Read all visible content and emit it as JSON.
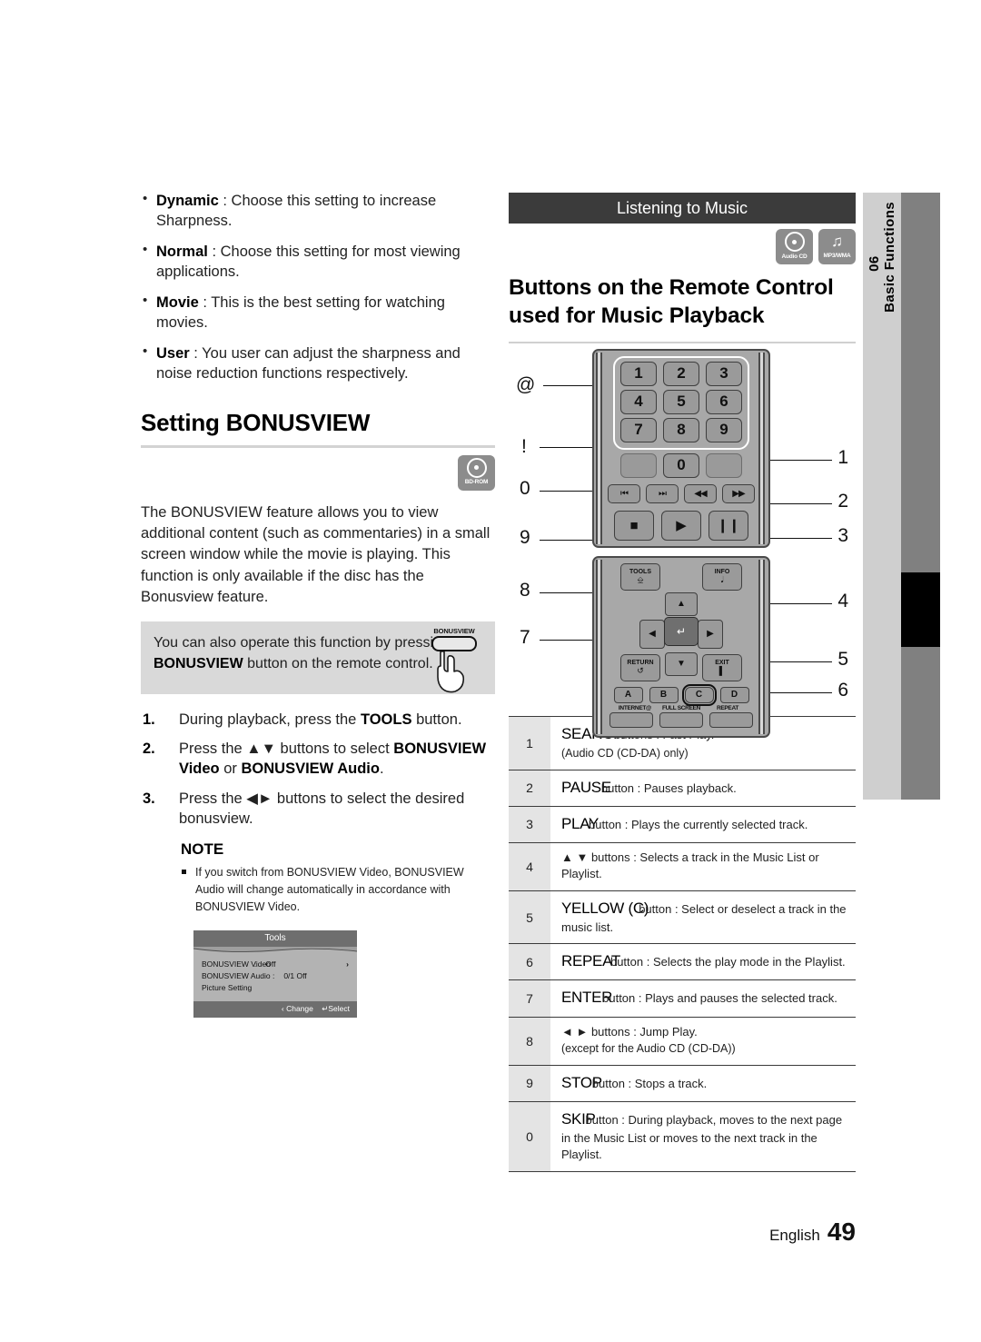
{
  "side_tab": {
    "number": "06",
    "label": "Basic Functions"
  },
  "left_column": {
    "bullets": [
      {
        "term": "Dynamic",
        "text": " : Choose this setting to increase Sharpness."
      },
      {
        "term": "Normal",
        "text": " : Choose this setting for most viewing applications."
      },
      {
        "term": "Movie",
        "text": " : This is the best setting for watching movies."
      },
      {
        "term": "User",
        "text": " : You user can adjust the sharpness and noise reduction functions respectively."
      }
    ],
    "section_title": "Setting BONUSVIEW",
    "disc_badge": {
      "label": "BD-ROM",
      "icon": "bd-rom-disc-icon"
    },
    "body": "The BONUSVIEW feature allows you to view additional content (such as commentaries) in a small screen window while the movie is playing. This function is only available if the disc has the Bonusview feature.",
    "tip": {
      "part1": "You can also operate this function by pressing the ",
      "bold": "BONUSVIEW",
      "part2": " button on the remote control.",
      "button_label": "BONUSVIEW"
    },
    "steps": [
      {
        "num": "1.",
        "html": "During playback, press the <b>TOOLS</b> button."
      },
      {
        "num": "2.",
        "html": "Press the ▲▼ buttons to select <b>BONUSVIEW Video</b> or <b>BONUSVIEW Audio</b>."
      },
      {
        "num": "3.",
        "html": "Press the ◄► buttons to select the desired bonusview."
      }
    ],
    "note_heading": "NOTE",
    "notes": [
      "If you switch from BONUSVIEW Video, BONUSVIEW Audio will change automatically in accordance with BONUSVIEW Video."
    ],
    "osd": {
      "title": "Tools",
      "rows": [
        {
          "label": "BONUSVIEW Video",
          "colon": ":",
          "value": "Off",
          "arrow": "›"
        },
        {
          "label": "BONUSVIEW Audio :",
          "colon": "",
          "value": "0/1 Off",
          "arrow": ""
        },
        {
          "label": "Picture Setting",
          "colon": "",
          "value": "",
          "arrow": ""
        }
      ],
      "footer_change": "‹  Change",
      "footer_select": "↵Select"
    }
  },
  "right_column": {
    "banner": "Listening to Music",
    "badges": [
      {
        "label": "Audio CD",
        "icon": "audio-cd-disc-icon"
      },
      {
        "label": "MP3/WMA",
        "icon": "music-note-icon"
      }
    ],
    "title": "Buttons on the Remote Control used for Music Playback",
    "remote": {
      "keys": [
        "1",
        "2",
        "3",
        "4",
        "5",
        "6",
        "7",
        "8",
        "9",
        "0"
      ],
      "transport": [
        "⏮",
        "⏭",
        "◀◀",
        "▶▶"
      ],
      "big": [
        "■",
        "▶",
        "❙❙"
      ],
      "tools_label": "TOOLS",
      "info_label": "INFO",
      "return_label": "RETURN",
      "exit_label": "EXIT",
      "color_buttons": [
        "A",
        "B",
        "C",
        "D"
      ],
      "function_labels": [
        "INTERNET@",
        "FULL SCREEN",
        "REPEAT"
      ],
      "callouts_left": [
        "@",
        "!",
        "0",
        "9"
      ],
      "callouts_right": [
        "1",
        "2",
        "3",
        "4",
        "5",
        "6"
      ],
      "callouts_lower_left": [
        "8",
        "7"
      ]
    },
    "table": [
      {
        "num": "1",
        "name": "SEARCH",
        "rest": "buttons : Fast Play.",
        "sub": "(Audio CD (CD-DA) only)"
      },
      {
        "num": "2",
        "name": "PAUSE",
        "rest": "button : Pauses playback.",
        "sub": ""
      },
      {
        "num": "3",
        "name": "PLAY",
        "rest": "button : Plays the currently selected track.",
        "sub": ""
      },
      {
        "num": "4",
        "name": "",
        "rest": "▲ ▼ buttons : Selects a track in the Music List or Playlist.",
        "sub": ""
      },
      {
        "num": "5",
        "name": "YELLOW (C)",
        "rest": "button : Select or deselect a track in the music list.",
        "sub": ""
      },
      {
        "num": "6",
        "name": "REPEAT",
        "rest": "button : Selects the play mode in the Playlist.",
        "sub": ""
      },
      {
        "num": "7",
        "name": "ENTER",
        "rest": "button : Plays and pauses the selected track.",
        "sub": ""
      },
      {
        "num": "8",
        "name": "",
        "rest": "◄ ►  buttons : Jump Play.",
        "sub": "(except for the Audio CD (CD-DA))"
      },
      {
        "num": "9",
        "name": "STOP",
        "rest": "button : Stops a track.",
        "sub": ""
      },
      {
        "num": "0",
        "name": "SKIP",
        "rest": "button : During playback, moves to the next page in the Music List or moves to the next track in the Playlist.",
        "sub": ""
      }
    ]
  },
  "footer": {
    "language": "English",
    "page": "49"
  }
}
